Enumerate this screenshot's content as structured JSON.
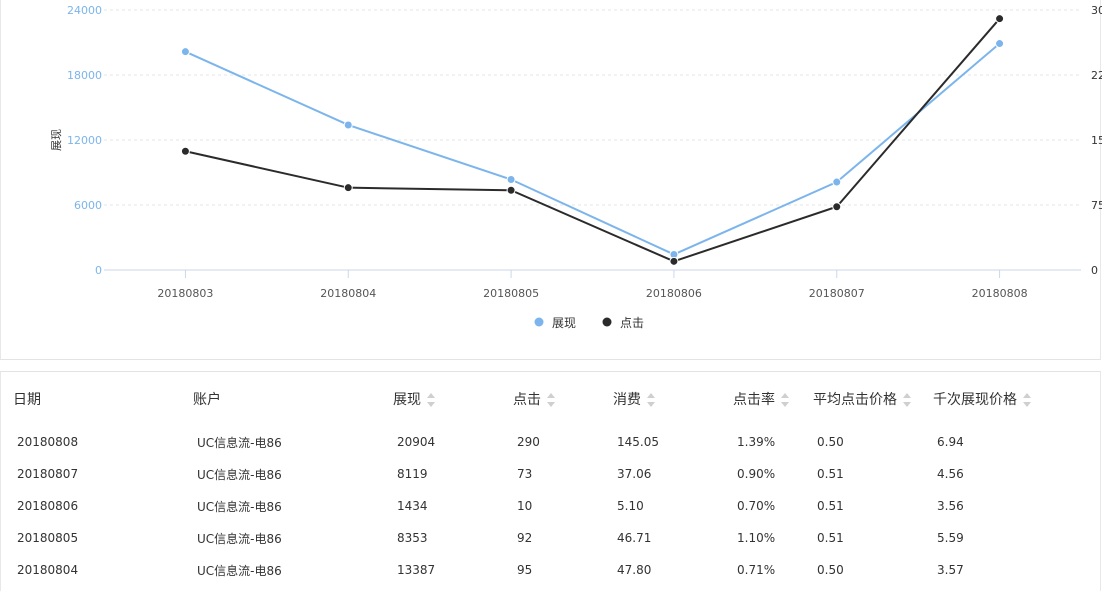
{
  "chart_data": {
    "type": "line",
    "categories": [
      "20180803",
      "20180804",
      "20180805",
      "20180806",
      "20180807",
      "20180808"
    ],
    "y_left": {
      "label": "展现",
      "ticks": [
        "0",
        "6000",
        "12000",
        "18000",
        "24000"
      ],
      "min": 0,
      "max": 24000
    },
    "y_right": {
      "ticks": [
        "0",
        "75",
        "15",
        "22",
        "30"
      ],
      "min": 0,
      "max": 300
    },
    "series": [
      {
        "name": "展现",
        "axis": "left",
        "color": "#7cb5ec",
        "values": [
          20154,
          13387,
          8353,
          1434,
          8119,
          20904
        ]
      },
      {
        "name": "点击",
        "axis": "right",
        "color": "#2b2b2b",
        "values": [
          137,
          95,
          92,
          10,
          73,
          290
        ]
      }
    ],
    "grid": true,
    "legend_position": "bottom-center"
  },
  "table": {
    "columns": [
      {
        "label": "日期",
        "sortable": false
      },
      {
        "label": "账户",
        "sortable": false
      },
      {
        "label": "展现",
        "sortable": true
      },
      {
        "label": "点击",
        "sortable": true
      },
      {
        "label": "消费",
        "sortable": true
      },
      {
        "label": "点击率",
        "sortable": true
      },
      {
        "label": "平均点击价格",
        "sortable": true
      },
      {
        "label": "千次展现价格",
        "sortable": true
      }
    ],
    "rows": [
      [
        "20180808",
        "UC信息流-电86",
        "20904",
        "290",
        "145.05",
        "1.39%",
        "0.50",
        "6.94"
      ],
      [
        "20180807",
        "UC信息流-电86",
        "8119",
        "73",
        "37.06",
        "0.90%",
        "0.51",
        "4.56"
      ],
      [
        "20180806",
        "UC信息流-电86",
        "1434",
        "10",
        "5.10",
        "0.70%",
        "0.51",
        "3.56"
      ],
      [
        "20180805",
        "UC信息流-电86",
        "8353",
        "92",
        "46.71",
        "1.10%",
        "0.51",
        "5.59"
      ],
      [
        "20180804",
        "UC信息流-电86",
        "13387",
        "95",
        "47.80",
        "0.71%",
        "0.50",
        "3.57"
      ]
    ]
  }
}
